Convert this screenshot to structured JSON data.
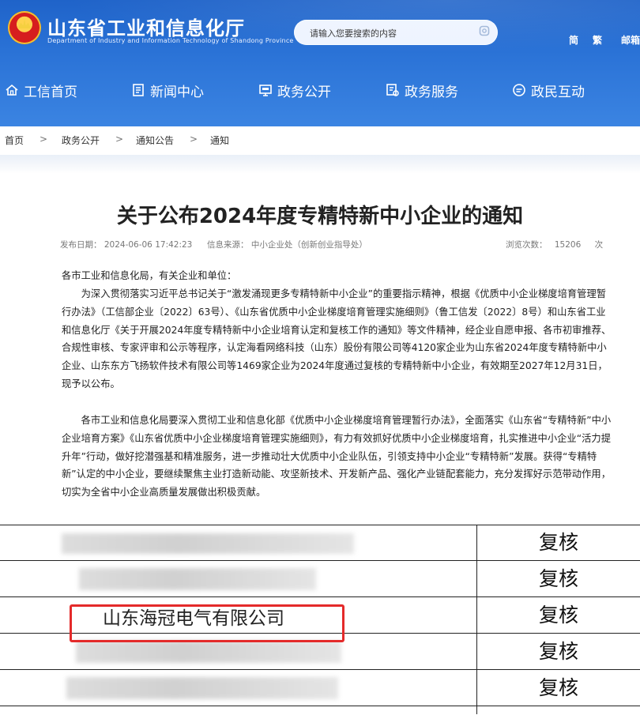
{
  "header": {
    "site_title": "山东省工业和信息化厅",
    "site_subtitle": "Department of Industry and Information Technology of Shandong Province",
    "search_placeholder": "请输入您要搜索的内容",
    "lang_simplified": "简",
    "lang_traditional": "繁",
    "mail": "邮箱"
  },
  "nav": [
    {
      "label": "工信首页",
      "icon": "home-icon"
    },
    {
      "label": "新闻中心",
      "icon": "document-icon"
    },
    {
      "label": "政务公开",
      "icon": "monitor-icon"
    },
    {
      "label": "政务服务",
      "icon": "service-icon"
    },
    {
      "label": "政民互动",
      "icon": "chat-icon"
    }
  ],
  "breadcrumb": [
    "首页",
    "政务公开",
    "通知公告",
    "通知"
  ],
  "breadcrumb_separator": ">",
  "article": {
    "title": "关于公布2024年度专精特新中小企业的通知",
    "meta": {
      "publish_label": "发布日期：",
      "publish_date": "2024-06-06 17:42:23",
      "source_label": "信息来源：",
      "source": "中小企业处（创新创业指导处）",
      "views_label": "浏览次数：",
      "views": "15206",
      "views_unit": "次"
    },
    "salutation": "各市工业和信息化局，有关企业和单位：",
    "paragraph_1": "为深入贯彻落实习近平总书记关于“激发涌现更多专精特新中小企业”的重要指示精神，根据《优质中小企业梯度培育管理暂行办法》（工信部企业〔2022〕63号）、《山东省优质中小企业梯度培育管理实施细则》（鲁工信发〔2022〕8号）和山东省工业和信息化厅《关于开展2024年度专精特新中小企业培育认定和复核工作的通知》等文件精神，经企业自愿申报、各市初审推荐、合规性审核、专家评审和公示等程序，认定海看网络科技（山东）股份有限公司等4120家企业为山东省2024年度专精特新中小企业、山东东方飞扬软件技术有限公司等1469家企业为2024年度通过复核的专精特新中小企业，有效期至2027年12月31日，现予以公布。",
    "paragraph_2": "各市工业和信息化局要深入贯彻工业和信息化部《优质中小企业梯度培育管理暂行办法》，全面落实《山东省“专精特新”中小企业培育方案》《山东省优质中小企业梯度培育管理实施细则》，有力有效抓好优质中小企业梯度培育，扎实推进中小企业“活力提升年”行动，做好挖潜强基和精准服务，进一步推动壮大优质中小企业队伍，引领支持中小企业“专精特新”发展。获得“专精特新”认定的中小企业，要继续聚焦主业打造新动能、攻坚新技术、开发新产品、强化产业链配套能力，充分发挥好示范带动作用，切实为全省中小企业高质量发展做出积极贡献。"
  },
  "table": {
    "rows": [
      {
        "company": "",
        "status": "复核"
      },
      {
        "company": "",
        "status": "复核"
      },
      {
        "company": "山东海冠电气有限公司",
        "status": "复核"
      },
      {
        "company": "",
        "status": "复核"
      },
      {
        "company": "",
        "status": "复核"
      }
    ],
    "highlight_color": "#e42a2a"
  },
  "colors": {
    "header_blue": "#2a72d6",
    "text": "#222222",
    "meta_gray": "#777777"
  }
}
